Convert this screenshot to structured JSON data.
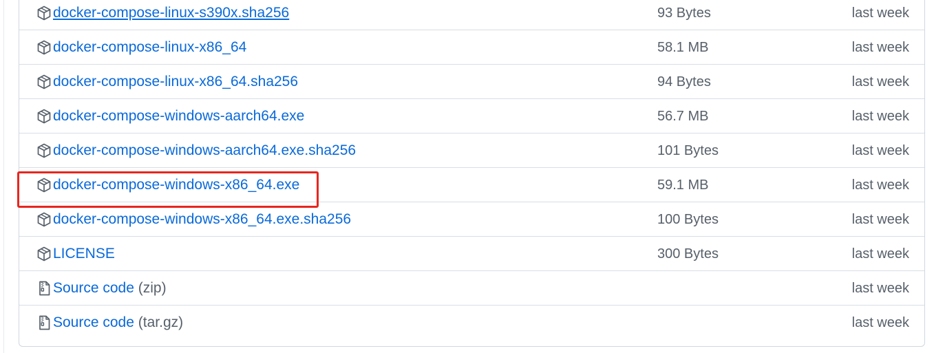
{
  "highlight_color": "#e8261f",
  "link_color": "#0969da",
  "muted_color": "#57606a",
  "assets": [
    {
      "name": "docker-compose-linux-s390x.sha256",
      "size": "93 Bytes",
      "time": "last week",
      "icon": "package-icon",
      "underline": true
    },
    {
      "name": "docker-compose-linux-x86_64",
      "size": "58.1 MB",
      "time": "last week",
      "icon": "package-icon"
    },
    {
      "name": "docker-compose-linux-x86_64.sha256",
      "size": "94 Bytes",
      "time": "last week",
      "icon": "package-icon"
    },
    {
      "name": "docker-compose-windows-aarch64.exe",
      "size": "56.7 MB",
      "time": "last week",
      "icon": "package-icon"
    },
    {
      "name": "docker-compose-windows-aarch64.exe.sha256",
      "size": "101 Bytes",
      "time": "last week",
      "icon": "package-icon"
    },
    {
      "name": "docker-compose-windows-x86_64.exe",
      "size": "59.1 MB",
      "time": "last week",
      "icon": "package-icon",
      "highlighted": true
    },
    {
      "name": "docker-compose-windows-x86_64.exe.sha256",
      "size": "100 Bytes",
      "time": "last week",
      "icon": "package-icon"
    },
    {
      "name": "LICENSE",
      "size": "300 Bytes",
      "time": "last week",
      "icon": "package-icon"
    }
  ],
  "source_code": [
    {
      "name": "Source code",
      "suffix": "(zip)",
      "time": "last week",
      "icon": "file-zip-icon"
    },
    {
      "name": "Source code",
      "suffix": "(tar.gz)",
      "time": "last week",
      "icon": "file-zip-icon"
    }
  ]
}
